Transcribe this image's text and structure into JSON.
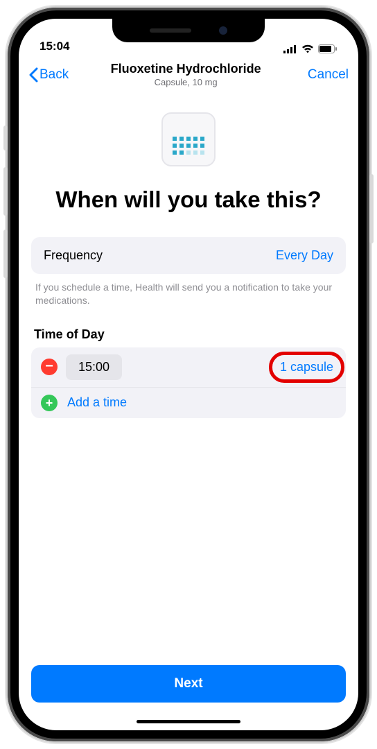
{
  "status": {
    "time": "15:04"
  },
  "nav": {
    "back": "Back",
    "title": "Fluoxetine Hydrochloride",
    "subtitle": "Capsule, 10 mg",
    "cancel": "Cancel"
  },
  "headline": "When will you take this?",
  "frequency": {
    "label": "Frequency",
    "value": "Every Day"
  },
  "hint": "If you schedule a time, Health will send you a notification to take your medications.",
  "timeOfDay": {
    "label": "Time of Day",
    "rows": [
      {
        "time": "15:00",
        "dose": "1 capsule"
      }
    ],
    "addLabel": "Add a time"
  },
  "footer": {
    "next": "Next"
  }
}
